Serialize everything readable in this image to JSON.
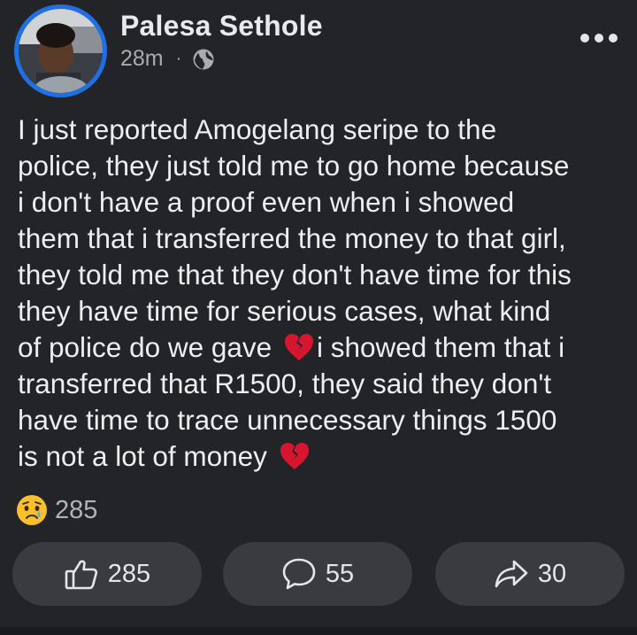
{
  "post": {
    "author": "Palesa Sethole",
    "time": "28m",
    "separator": "·",
    "audience_icon": "globe-icon",
    "more_icon": "more-options-icon",
    "text_lines": [
      "I just reported Amogelang seripe to the",
      "police, they just told me to go home because",
      "i don't have a proof even when i showed",
      "them that i transferred the money to that girl,",
      "they told me that they don't have time for this",
      "they have time for serious cases, what kind",
      "of police do we gave ",
      "i showed them that i",
      "transferred that R1500, they said they don't",
      "have time to trace unnecessary things 1500",
      "is not a lot of money "
    ],
    "emoji": "broken-heart-icon"
  },
  "reactions": {
    "icon": "sad-face-icon",
    "count": "285"
  },
  "actions": {
    "like": {
      "icon": "thumbs-up-icon",
      "count": "285"
    },
    "comment": {
      "icon": "comment-icon",
      "count": "55"
    },
    "share": {
      "icon": "share-icon",
      "count": "30"
    }
  },
  "colors": {
    "background": "#232428",
    "avatar_ring": "#1f6fe5",
    "button": "#3a3b3f",
    "text": "#eceef1",
    "muted": "#a8abb1",
    "broken_heart": "#d6162f"
  }
}
